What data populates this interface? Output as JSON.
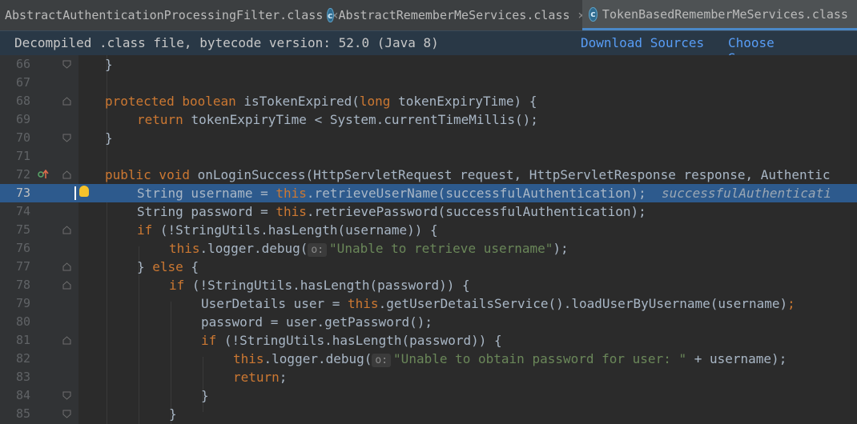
{
  "tabs": [
    {
      "label": "AbstractAuthenticationProcessingFilter.class",
      "close": "×",
      "icon": "class-icon",
      "active": false
    },
    {
      "label": "AbstractRememberMeServices.class",
      "close": "×",
      "icon": "class-icon",
      "active": false
    },
    {
      "label": "TokenBasedRememberMeServices.class",
      "close": "×",
      "icon": "class-icon",
      "active": true
    }
  ],
  "banner": {
    "message": "Decompiled .class file, bytecode version: 52.0 (Java 8)",
    "download_sources": "Download Sources",
    "choose_sources": "Choose Sources..."
  },
  "class_icon_glyph": "c",
  "colors": {
    "keyword": "#cc7832",
    "string": "#6a8759",
    "text": "#a9b7c6",
    "highlight": "#2d5a8d",
    "link": "#589df6"
  },
  "lines": [
    {
      "num": "66"
    },
    {
      "num": "67"
    },
    {
      "num": "68"
    },
    {
      "num": "69"
    },
    {
      "num": "70"
    },
    {
      "num": "71"
    },
    {
      "num": "72"
    },
    {
      "num": "73"
    },
    {
      "num": "74"
    },
    {
      "num": "75"
    },
    {
      "num": "76"
    },
    {
      "num": "77"
    },
    {
      "num": "78"
    },
    {
      "num": "79"
    },
    {
      "num": "80"
    },
    {
      "num": "81"
    },
    {
      "num": "82"
    },
    {
      "num": "83"
    },
    {
      "num": "84"
    },
    {
      "num": "85"
    }
  ],
  "code": {
    "l66": {
      "t1": "}"
    },
    "l68": {
      "k1": "protected boolean ",
      "t1": "isTokenExpired(",
      "k2": "long ",
      "t2": "tokenExpiryTime) {"
    },
    "l69": {
      "k1": "return ",
      "t1": "tokenExpiryTime < System.currentTimeMillis();"
    },
    "l70": {
      "t1": "}"
    },
    "l72": {
      "k1": "public void ",
      "t1": "onLoginSuccess(HttpServletRequest request, HttpServletResponse response, Authentic"
    },
    "l73": {
      "t1": "String username = ",
      "k1": "this",
      "t2": ".retrieveUserName(successfulAuthentication);",
      "inline": "successfulAuthenticati"
    },
    "l74": {
      "t1": "String password = ",
      "k1": "this",
      "t2": ".retrievePassword(successfulAuthentication);"
    },
    "l75": {
      "k1": "if ",
      "t1": "(!StringUtils.hasLength(username)) {"
    },
    "l76": {
      "k1": "this",
      "t1": ".logger.debug(",
      "hint": "o:",
      "s1": "\"Unable to retrieve username\"",
      "t2": ");"
    },
    "l77": {
      "t1": "} ",
      "k1": "else ",
      "t2": "{"
    },
    "l78": {
      "k1": "if ",
      "t1": "(!StringUtils.hasLength(password)) {"
    },
    "l79": {
      "t1": "UserDetails user = ",
      "k1": "this",
      "t2": ".getUserDetailsService().loadUserByUsername(username)",
      "k2": ";"
    },
    "l80": {
      "t1": "password = user.getPassword();"
    },
    "l81": {
      "k1": "if ",
      "t1": "(!StringUtils.hasLength(password)) {"
    },
    "l82": {
      "k1": "this",
      "t1": ".logger.debug(",
      "hint": "o:",
      "s1": "\"Unable to obtain password for user: \"",
      "t2": " + username);"
    },
    "l83": {
      "k1": "return",
      "t1": ";"
    },
    "l84": {
      "t1": "}"
    },
    "l85": {
      "t1": "}"
    }
  }
}
